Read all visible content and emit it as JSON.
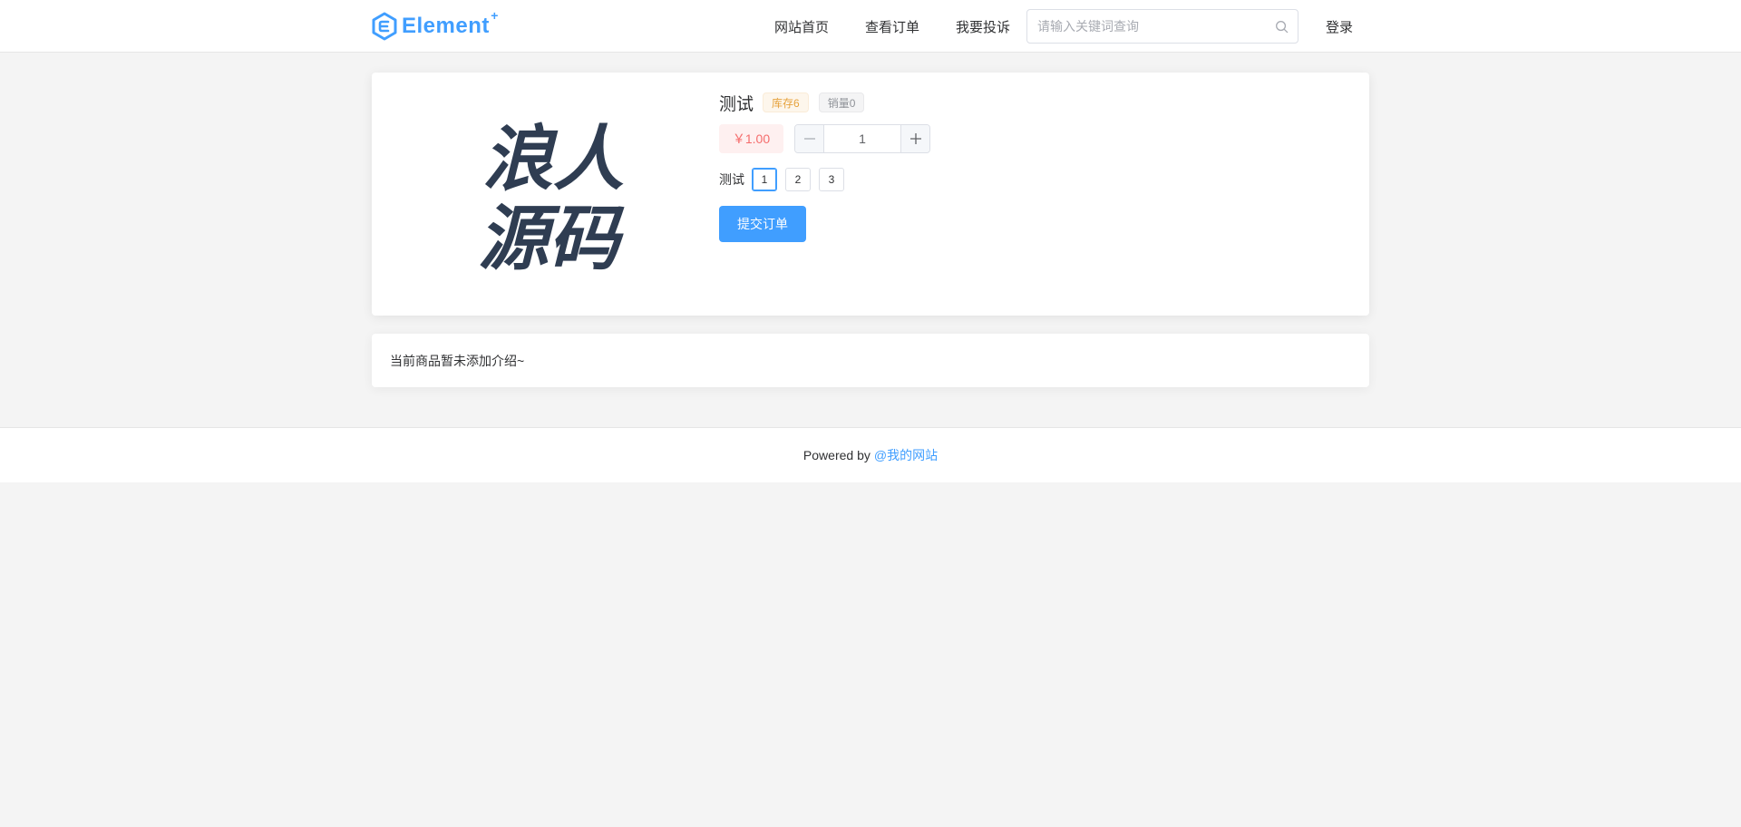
{
  "header": {
    "logo_text": "Element",
    "logo_sup": "+",
    "nav": [
      {
        "label": "网站首页"
      },
      {
        "label": "查看订单"
      },
      {
        "label": "我要投诉"
      }
    ],
    "search": {
      "placeholder": "请输入关键词查询",
      "value": ""
    },
    "login_label": "登录"
  },
  "product": {
    "image_text_line1": "浪人",
    "image_text_line2": "源码",
    "title": "测试",
    "stock_tag": "库存6",
    "sales_tag": "销量0",
    "price": "￥1.00",
    "quantity": "1",
    "spec_label": "测试",
    "spec_options": [
      "1",
      "2",
      "3"
    ],
    "selected_spec": "1",
    "submit_label": "提交订单"
  },
  "description": {
    "text": "当前商品暂未添加介绍~"
  },
  "footer": {
    "powered_by": "Powered by",
    "link_text": "@我的网站"
  },
  "colors": {
    "primary": "#409eff",
    "price_text": "#f56c6c",
    "stock_tag": "#e6a23c",
    "sales_tag": "#909399"
  },
  "icons": {
    "logo": "element-hexagon-icon",
    "search": "search-icon",
    "minus": "minus-icon",
    "plus": "plus-icon"
  }
}
